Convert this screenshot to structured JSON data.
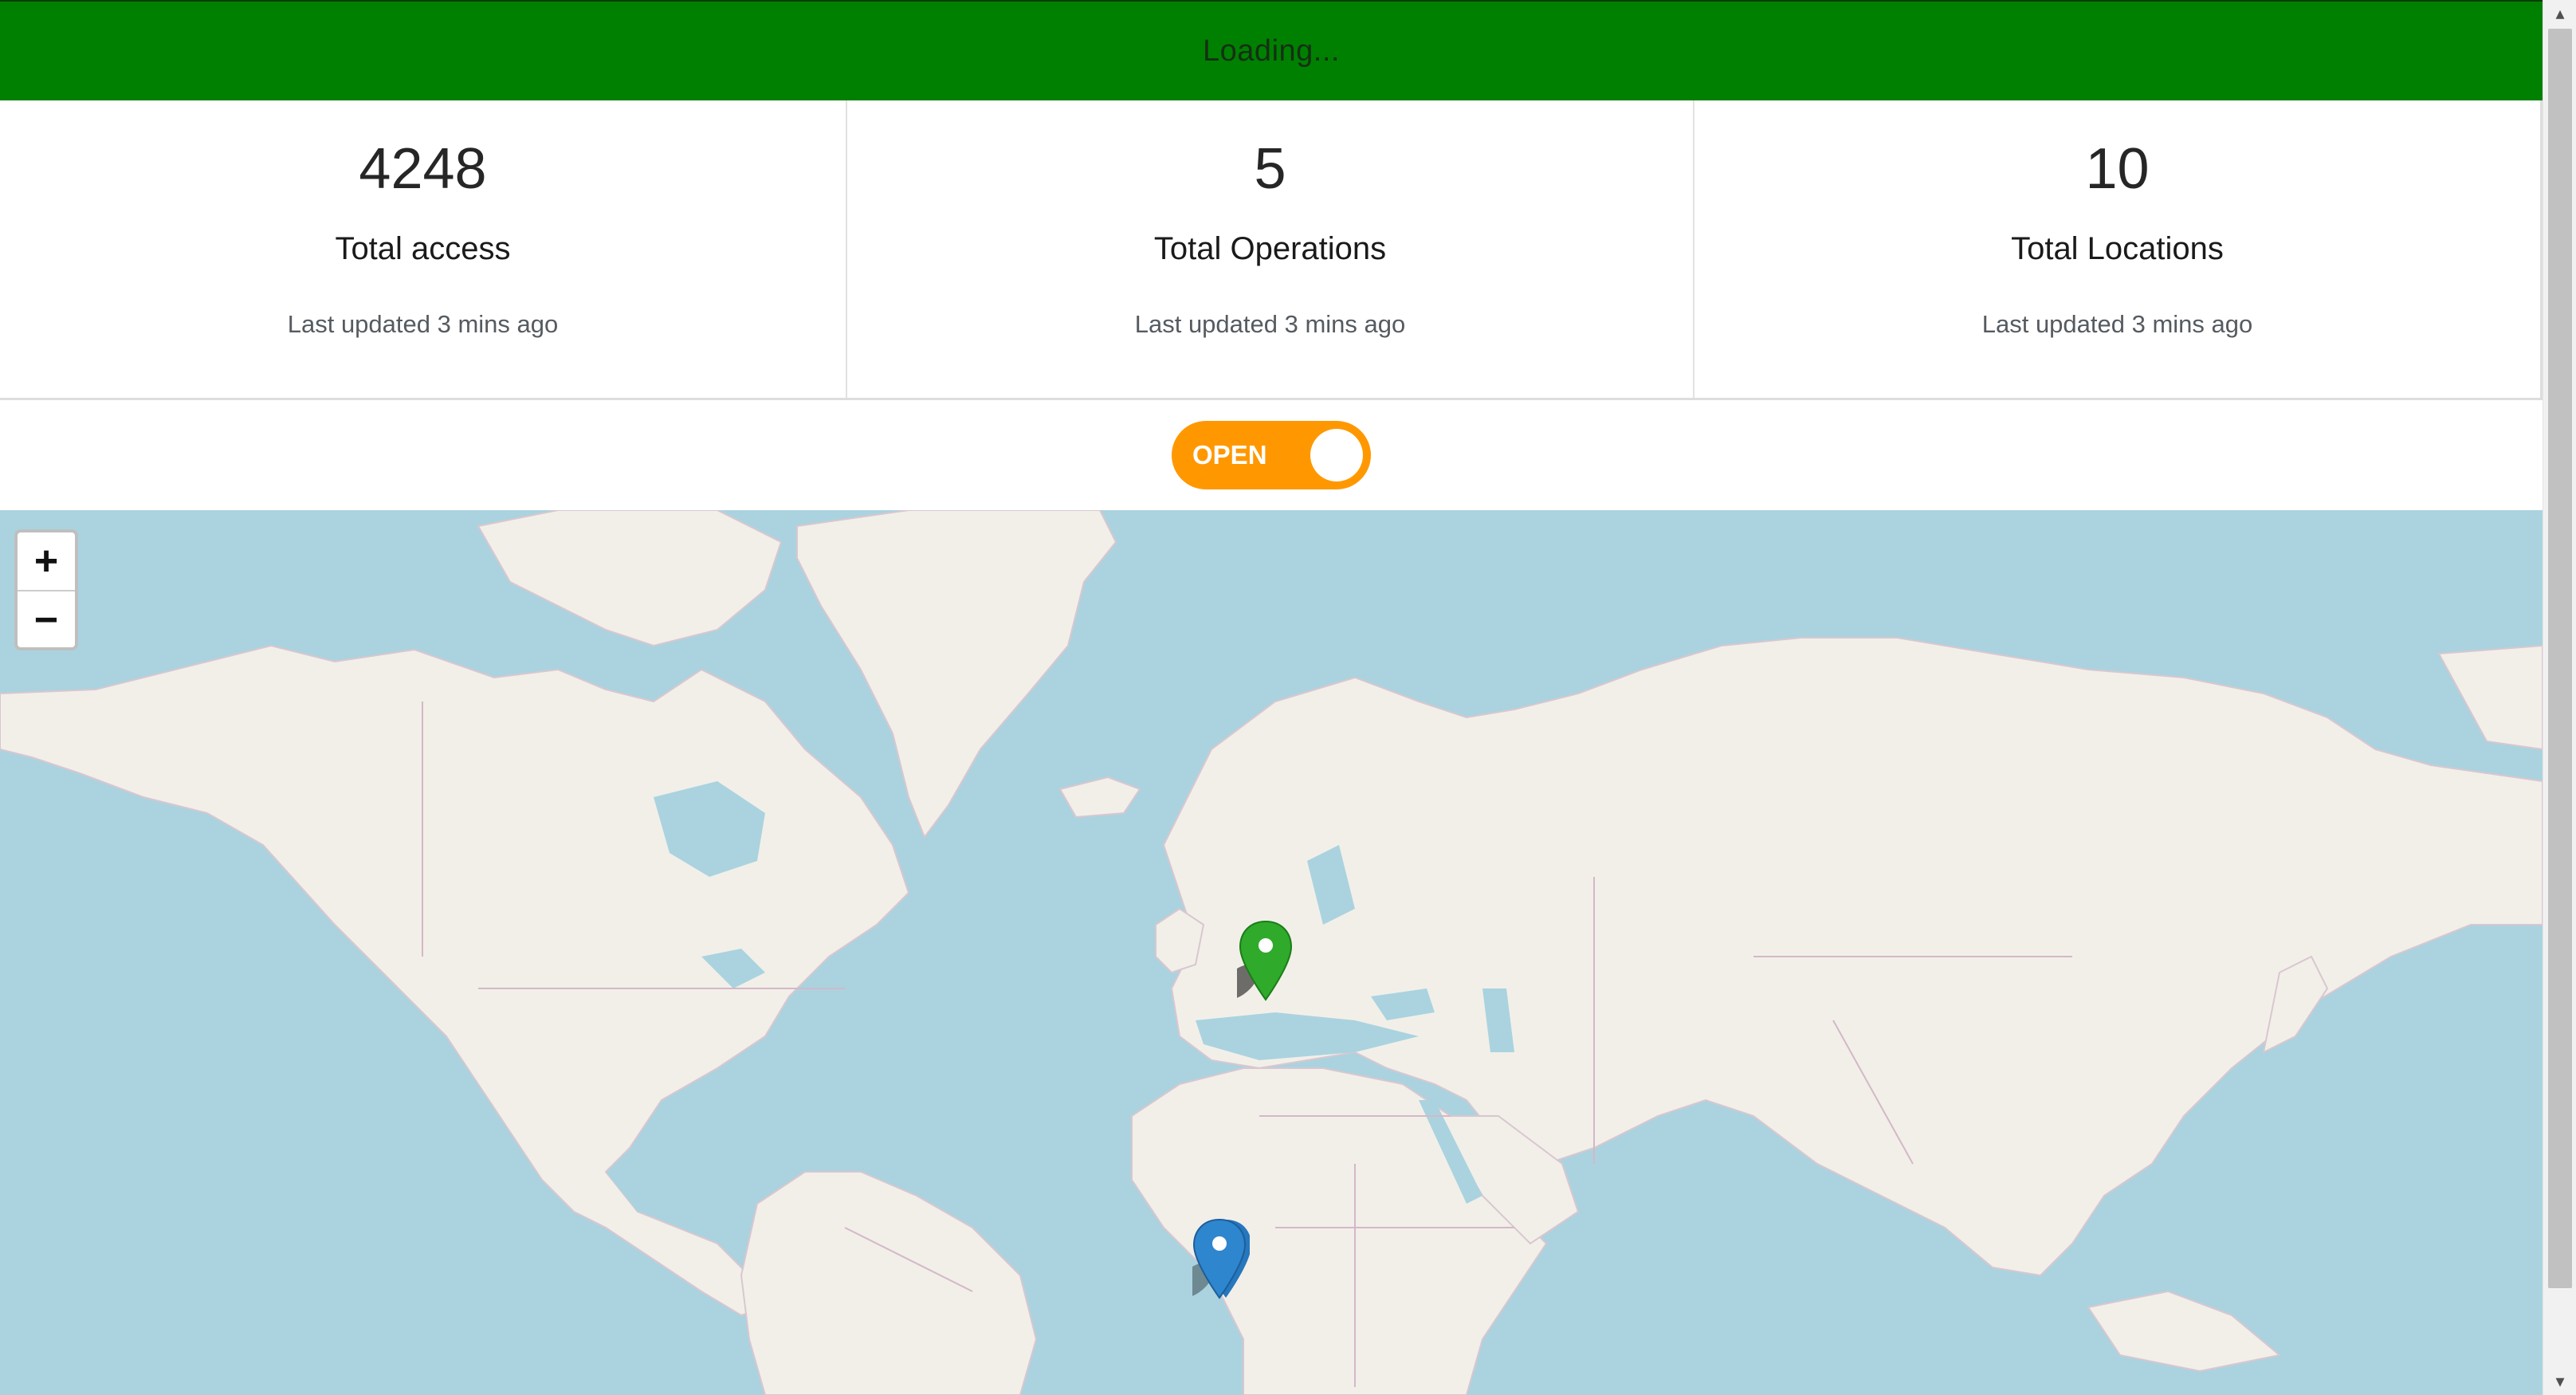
{
  "banner": {
    "text": "Loading..."
  },
  "stats": [
    {
      "value": "4248",
      "title": "Total access",
      "updated": "Last updated 3 mins ago"
    },
    {
      "value": "5",
      "title": "Total Operations",
      "updated": "Last updated 3 mins ago"
    },
    {
      "value": "10",
      "title": "Total Locations",
      "updated": "Last updated 3 mins ago"
    }
  ],
  "toggle": {
    "label": "OPEN",
    "state": "on",
    "color": "#ff9800"
  },
  "map": {
    "zoom_in_label": "+",
    "zoom_out_label": "−",
    "water_color": "#aad3df",
    "land_color": "#f2efe9",
    "markers": [
      {
        "name": "europe-marker",
        "color": "#2faa2b",
        "icon": "map-pin-icon"
      },
      {
        "name": "west-africa-marker",
        "color": "#2e86cf",
        "icon": "map-pin-icon"
      }
    ]
  },
  "colors": {
    "banner": "#008000",
    "accent": "#ff9800"
  }
}
